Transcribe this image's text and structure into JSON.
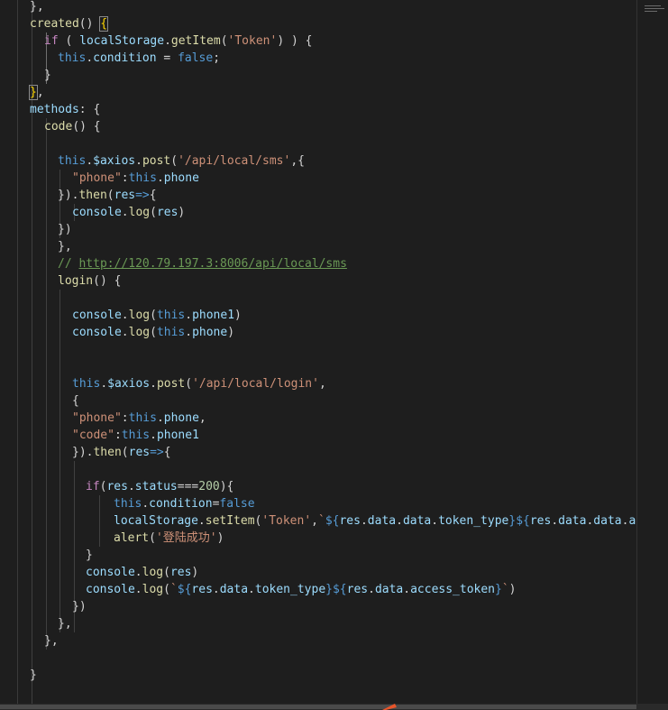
{
  "editor": {
    "lines": [
      [
        [
          "},",
          "pun"
        ]
      ],
      [
        [
          "created",
          "fn"
        ],
        [
          "() ",
          "pun"
        ],
        [
          "{",
          "bm"
        ]
      ],
      [
        [
          "if",
          "ctl"
        ],
        [
          " ( ",
          "pun"
        ],
        [
          "localStorage",
          "var"
        ],
        [
          ".",
          "pun"
        ],
        [
          "getItem",
          "fn"
        ],
        [
          "(",
          "pun"
        ],
        [
          "'Token'",
          "str"
        ],
        [
          ") ) {",
          "pun"
        ]
      ],
      [
        [
          "this",
          "kw"
        ],
        [
          ".",
          "pun"
        ],
        [
          "condition",
          "var"
        ],
        [
          " = ",
          "pun"
        ],
        [
          "false",
          "kw"
        ],
        [
          ";",
          "pun"
        ]
      ],
      [
        [
          "}",
          "pun"
        ]
      ],
      [
        [
          "}",
          "bm"
        ],
        [
          ",",
          "pun"
        ]
      ],
      [
        [
          "methods",
          "var"
        ],
        [
          ": {",
          "pun"
        ]
      ],
      [
        [
          "code",
          "fn"
        ],
        [
          "() {",
          "pun"
        ]
      ],
      [],
      [
        [
          "this",
          "kw"
        ],
        [
          ".",
          "pun"
        ],
        [
          "$axios",
          "var"
        ],
        [
          ".",
          "pun"
        ],
        [
          "post",
          "fn"
        ],
        [
          "(",
          "pun"
        ],
        [
          "'/api/local/sms'",
          "str"
        ],
        [
          ",{",
          "pun"
        ]
      ],
      [
        [
          "\"phone\"",
          "str"
        ],
        [
          ":",
          "pun"
        ],
        [
          "this",
          "kw"
        ],
        [
          ".",
          "pun"
        ],
        [
          "phone",
          "var"
        ]
      ],
      [
        [
          "}).",
          "pun"
        ],
        [
          "then",
          "fn"
        ],
        [
          "(",
          "pun"
        ],
        [
          "res",
          "var"
        ],
        [
          "=>",
          "kw"
        ],
        [
          "{",
          "pun"
        ]
      ],
      [
        [
          "console",
          "var"
        ],
        [
          ".",
          "pun"
        ],
        [
          "log",
          "fn"
        ],
        [
          "(",
          "pun"
        ],
        [
          "res",
          "var"
        ],
        [
          ")",
          "pun"
        ]
      ],
      [
        [
          "})",
          "pun"
        ]
      ],
      [
        [
          "},",
          "pun"
        ]
      ],
      [
        [
          "// ",
          "cmt"
        ],
        [
          "http://120.79.197.3:8006/api/local/sms",
          "url"
        ]
      ],
      [
        [
          "login",
          "fn"
        ],
        [
          "() {",
          "pun"
        ]
      ],
      [],
      [
        [
          "console",
          "var"
        ],
        [
          ".",
          "pun"
        ],
        [
          "log",
          "fn"
        ],
        [
          "(",
          "pun"
        ],
        [
          "this",
          "kw"
        ],
        [
          ".",
          "pun"
        ],
        [
          "phone1",
          "var"
        ],
        [
          ")",
          "pun"
        ]
      ],
      [
        [
          "console",
          "var"
        ],
        [
          ".",
          "pun"
        ],
        [
          "log",
          "fn"
        ],
        [
          "(",
          "pun"
        ],
        [
          "this",
          "kw"
        ],
        [
          ".",
          "pun"
        ],
        [
          "phone",
          "var"
        ],
        [
          ")",
          "pun"
        ]
      ],
      [],
      [],
      [
        [
          "this",
          "kw"
        ],
        [
          ".",
          "pun"
        ],
        [
          "$axios",
          "var"
        ],
        [
          ".",
          "pun"
        ],
        [
          "post",
          "fn"
        ],
        [
          "(",
          "pun"
        ],
        [
          "'/api/local/login'",
          "str"
        ],
        [
          ",",
          "pun"
        ]
      ],
      [
        [
          "{",
          "pun"
        ]
      ],
      [
        [
          "\"phone\"",
          "str"
        ],
        [
          ":",
          "pun"
        ],
        [
          "this",
          "kw"
        ],
        [
          ".",
          "pun"
        ],
        [
          "phone",
          "var"
        ],
        [
          ",",
          "pun"
        ]
      ],
      [
        [
          "\"code\"",
          "str"
        ],
        [
          ":",
          "pun"
        ],
        [
          "this",
          "kw"
        ],
        [
          ".",
          "pun"
        ],
        [
          "phone1",
          "var"
        ]
      ],
      [
        [
          "}).",
          "pun"
        ],
        [
          "then",
          "fn"
        ],
        [
          "(",
          "pun"
        ],
        [
          "res",
          "var"
        ],
        [
          "=>",
          "kw"
        ],
        [
          "{",
          "pun"
        ]
      ],
      [],
      [
        [
          "if",
          "ctl"
        ],
        [
          "(",
          "pun"
        ],
        [
          "res",
          "var"
        ],
        [
          ".",
          "pun"
        ],
        [
          "status",
          "var"
        ],
        [
          "===",
          "pun"
        ],
        [
          "200",
          "num"
        ],
        [
          "){",
          "pun"
        ]
      ],
      [
        [
          "this",
          "kw"
        ],
        [
          ".",
          "pun"
        ],
        [
          "condition",
          "var"
        ],
        [
          "=",
          "pun"
        ],
        [
          "false",
          "kw"
        ]
      ],
      [
        [
          "localStorage",
          "var"
        ],
        [
          ".",
          "pun"
        ],
        [
          "setItem",
          "fn"
        ],
        [
          "(",
          "pun"
        ],
        [
          "'Token'",
          "str"
        ],
        [
          ",",
          "pun"
        ],
        [
          "`",
          "str"
        ],
        [
          "${",
          "kw"
        ],
        [
          "res",
          "var"
        ],
        [
          ".",
          "pun"
        ],
        [
          "data",
          "var"
        ],
        [
          ".",
          "pun"
        ],
        [
          "data",
          "var"
        ],
        [
          ".",
          "pun"
        ],
        [
          "token_type",
          "var"
        ],
        [
          "}",
          "kw"
        ],
        [
          "${",
          "kw"
        ],
        [
          "res",
          "var"
        ],
        [
          ".",
          "pun"
        ],
        [
          "data",
          "var"
        ],
        [
          ".",
          "pun"
        ],
        [
          "data",
          "var"
        ],
        [
          ".",
          "pun"
        ],
        [
          "acc",
          "var"
        ]
      ],
      [
        [
          "alert",
          "fn"
        ],
        [
          "(",
          "pun"
        ],
        [
          "'登陆成功'",
          "str"
        ],
        [
          ")",
          "pun"
        ]
      ],
      [
        [
          "}",
          "pun"
        ]
      ],
      [
        [
          "console",
          "var"
        ],
        [
          ".",
          "pun"
        ],
        [
          "log",
          "fn"
        ],
        [
          "(",
          "pun"
        ],
        [
          "res",
          "var"
        ],
        [
          ")",
          "pun"
        ]
      ],
      [
        [
          "console",
          "var"
        ],
        [
          ".",
          "pun"
        ],
        [
          "log",
          "fn"
        ],
        [
          "(",
          "pun"
        ],
        [
          "`",
          "str"
        ],
        [
          "${",
          "kw"
        ],
        [
          "res",
          "var"
        ],
        [
          ".",
          "pun"
        ],
        [
          "data",
          "var"
        ],
        [
          ".",
          "pun"
        ],
        [
          "token_type",
          "var"
        ],
        [
          "}",
          "kw"
        ],
        [
          "${",
          "kw"
        ],
        [
          "res",
          "var"
        ],
        [
          ".",
          "pun"
        ],
        [
          "data",
          "var"
        ],
        [
          ".",
          "pun"
        ],
        [
          "access_token",
          "var"
        ],
        [
          "}",
          "kw"
        ],
        [
          "`",
          "str"
        ],
        [
          ")",
          "pun"
        ]
      ],
      [
        [
          "})",
          "pun"
        ]
      ],
      [
        [
          "},",
          "pun"
        ]
      ],
      [
        [
          "},",
          "pun"
        ]
      ],
      [],
      [
        [
          "}",
          "pun"
        ]
      ]
    ]
  },
  "colors": {
    "background": "#1e1e1e",
    "keyword": "#569cd6",
    "control": "#c586c0",
    "function": "#dcdcaa",
    "variable": "#9cdcfe",
    "string": "#ce9178",
    "number": "#b5cea8",
    "comment": "#6a9955"
  }
}
